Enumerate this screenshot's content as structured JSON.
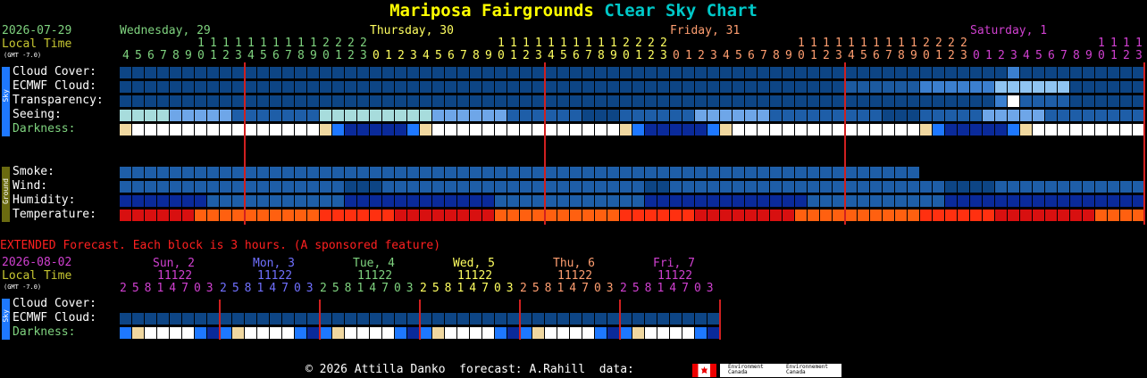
{
  "title": {
    "location": "Mariposa Fairgrounds",
    "suffix": "Clear Sky Chart"
  },
  "colors": {
    "location": "#ffff00",
    "suffix": "#00c8c8",
    "green": "#7fd37f",
    "local": "#c8c832",
    "red": "#ff2020",
    "lines": "#d02020",
    "sky_side": "#1e78ff",
    "ground_side": "#6a6a10"
  },
  "main": {
    "date": "2026-07-29",
    "local_time": "Local Time",
    "gmt": "(GMT -7.0)",
    "days": [
      {
        "label": "Wednesday, 29",
        "color": "#7fd37f",
        "col": 0
      },
      {
        "label": "Thursday, 30",
        "color": "#ffff60",
        "col": 17
      },
      {
        "label": "Friday, 31",
        "color": "#ff9e70",
        "col": 38
      },
      {
        "label": "Saturday, 1",
        "color": "#d040d0",
        "col": 59
      }
    ],
    "hour_digits": {
      "top": "11111122221111111111222211111111112222111111111122222",
      "bottom": "4567890123012345678901230123456789012301234567890123012345678901230123"
    },
    "sky_labels": [
      "Cloud Cover:",
      "ECMWF Cloud:",
      "Transparency:",
      "Seeing:",
      "Darkness:"
    ],
    "ground_labels": [
      "Smoke:",
      "Wind:",
      "Humidity:",
      "Temperature:"
    ],
    "sky_side": "Sky",
    "ground_side": "Ground"
  },
  "extended": {
    "heading": "EXTENDED Forecast. Each block is 3 hours. (A sponsored feature)",
    "date": "2026-08-02",
    "local_time": "Local Time",
    "gmt": "(GMT -7.0)",
    "days": [
      {
        "label": "Sun, 2",
        "color": "#d040d0"
      },
      {
        "label": "Mon, 3",
        "color": "#7070ff"
      },
      {
        "label": "Tue, 4",
        "color": "#7fd37f"
      },
      {
        "label": "Wed, 5",
        "color": "#ffff60"
      },
      {
        "label": "Thu, 6",
        "color": "#ff9e70"
      },
      {
        "label": "Fri, 7",
        "color": "#d040d0"
      }
    ],
    "hours_top": "11122",
    "hours_bottom": "25814703",
    "labels": [
      "Cloud Cover:",
      "ECMWF Cloud:",
      "Darkness:"
    ],
    "sky_side": "Sky"
  },
  "footer": {
    "text": "© 2026 Attilla Danko  forecast: A.Rahill  data:",
    "logo_en": "Environment Canada",
    "logo_fr": "Environnement Canada"
  }
}
